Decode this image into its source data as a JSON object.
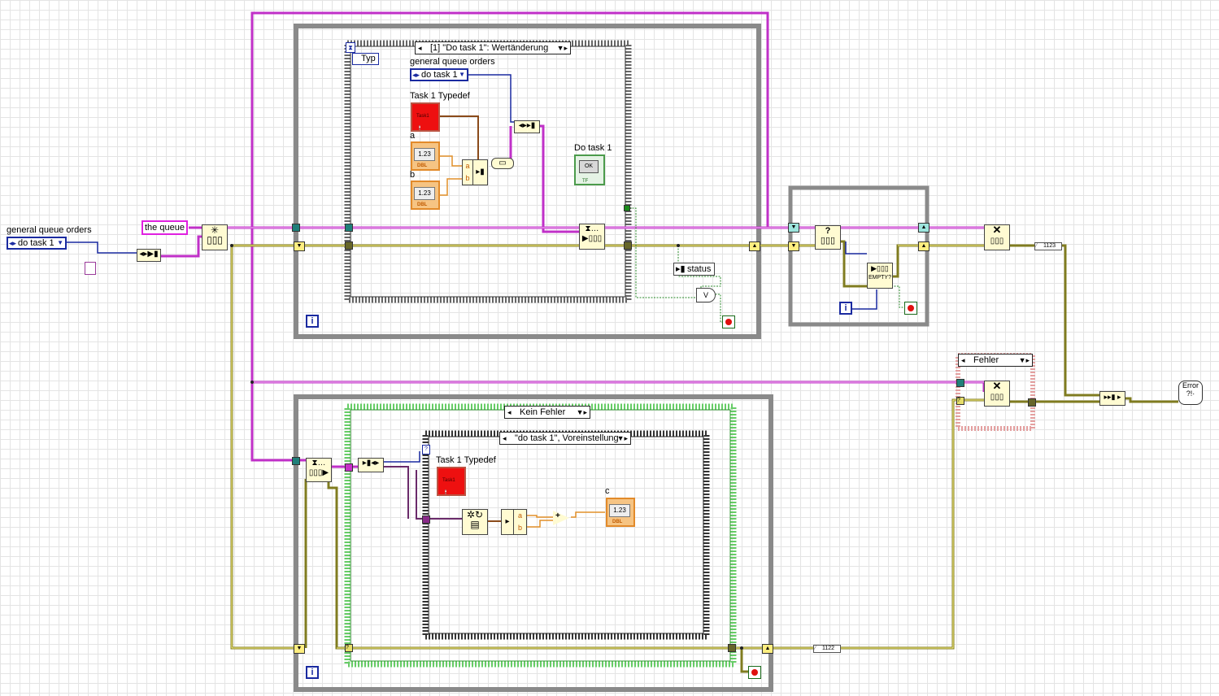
{
  "producer_loop": {
    "case_structure": {
      "selector": "[1] \"Do task 1\": Wertänderung"
    },
    "type_label": "Typ",
    "queue_orders_label": "general queue orders",
    "queue_orders_value": "do task 1",
    "task_typedef_label": "Task 1 Typedef",
    "task_const_text": "Task1",
    "task_const_type": "",
    "label_a": "a",
    "label_b": "b",
    "num_a": "1.23",
    "num_b": "1.23",
    "num_type": "DBL",
    "bundle_a": "a",
    "bundle_b": "b",
    "do_task_label": "Do task 1",
    "do_task_button": "OK",
    "do_task_type": "TF",
    "status_label": "status",
    "or_glyph": "V",
    "iteration": "i"
  },
  "outside": {
    "queue_orders_label": "general queue orders",
    "queue_orders_value": "do task 1",
    "queue_name": "the queue"
  },
  "empty_check_loop": {
    "empty_label": "EMPTY?",
    "query_glyph": "?",
    "iteration": "i"
  },
  "consumer_loop": {
    "error_case": {
      "selector": "Kein Fehler"
    },
    "task_case": {
      "selector": "\"do task 1\", Voreinstellung"
    },
    "task_typedef_label": "Task 1 Typedef",
    "task_const_text": "Task1",
    "unbundle_a": "a",
    "unbundle_b": "b",
    "add_glyph": "+",
    "result_label": "c",
    "result_value": "1.23",
    "result_type": "DBL",
    "iteration": "i"
  },
  "error_case": {
    "selector": "Fehler"
  },
  "constants": {
    "status_const_top": "1123",
    "status_const_bottom": "1122"
  },
  "error_handler": {
    "text": "Error"
  }
}
